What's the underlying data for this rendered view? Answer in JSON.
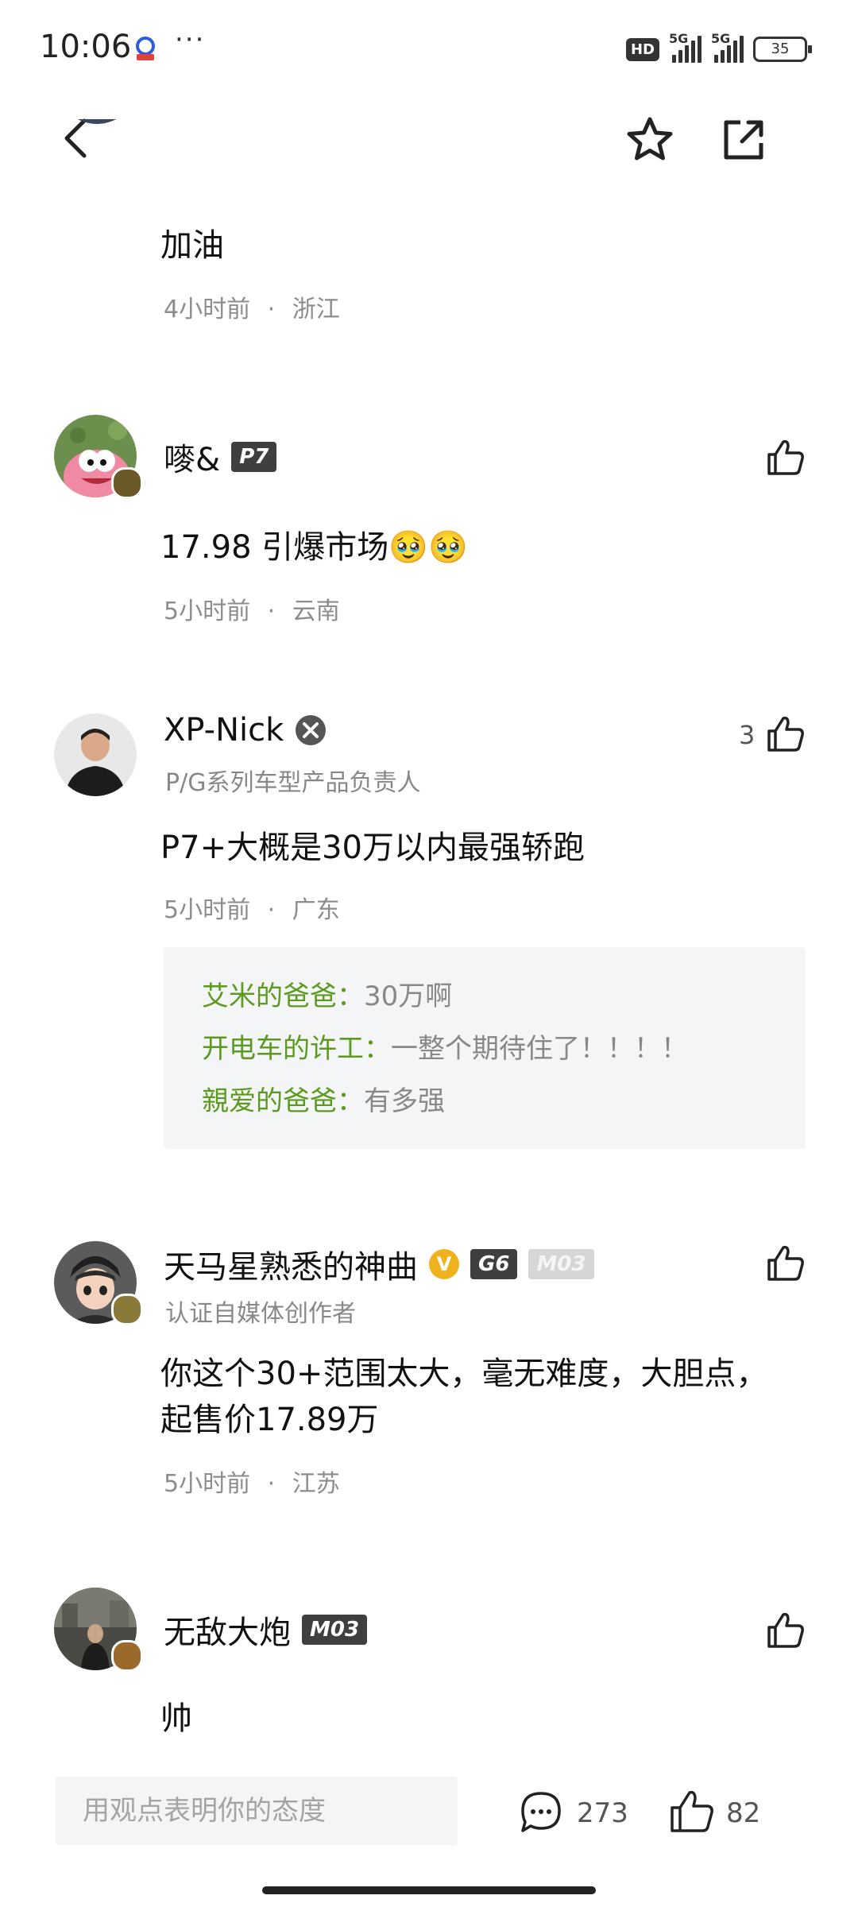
{
  "status_bar": {
    "time": "10:06",
    "dots": "···",
    "hd": "HD",
    "sim1": "5G",
    "sim2": "5G",
    "battery": "35"
  },
  "nav": {
    "back_icon": "chevron-left-icon",
    "favorite_icon": "star-icon",
    "share_icon": "share-icon"
  },
  "comments": [
    {
      "content": "加油",
      "time": "4小时前",
      "location": "浙江"
    },
    {
      "name": "嘜&",
      "tags": [
        "P7"
      ],
      "content": "17.98 引爆市场🥹🥹",
      "time": "5小时前",
      "location": "云南"
    },
    {
      "name": "XP-Nick",
      "subtitle": "P/G系列车型产品负责人",
      "like_count": "3",
      "content": "P7+大概是30万以内最强轿跑",
      "time": "5小时前",
      "location": "广东",
      "replies": [
        {
          "name": "艾米的爸爸",
          "text": "30万啊"
        },
        {
          "name": "开电车的许工",
          "text": "一整个期待住了！！！！"
        },
        {
          "name": "親爱的爸爸",
          "text": "有多强"
        }
      ]
    },
    {
      "name": "天马星熟悉的神曲",
      "verified": "V",
      "tags": [
        "G6",
        "M03"
      ],
      "subtitle": "认证自媒体创作者",
      "content": "你这个30+范围太大，毫无难度，大胆点，起售价17.89万",
      "time": "5小时前",
      "location": "江苏"
    },
    {
      "name": "无敌大炮",
      "tags": [
        "M03"
      ],
      "content": "帅"
    }
  ],
  "meta_separator": "·",
  "reply_colon": "：",
  "bottom_bar": {
    "input_placeholder": "用观点表明你的态度",
    "comment_count": "273",
    "like_count": "82"
  },
  "colors": {
    "reply_name": "#5c9a1f",
    "reply_bg": "#f4f5f6",
    "tag_bg": "#3f3f3f",
    "verified": "#f0b21c"
  }
}
